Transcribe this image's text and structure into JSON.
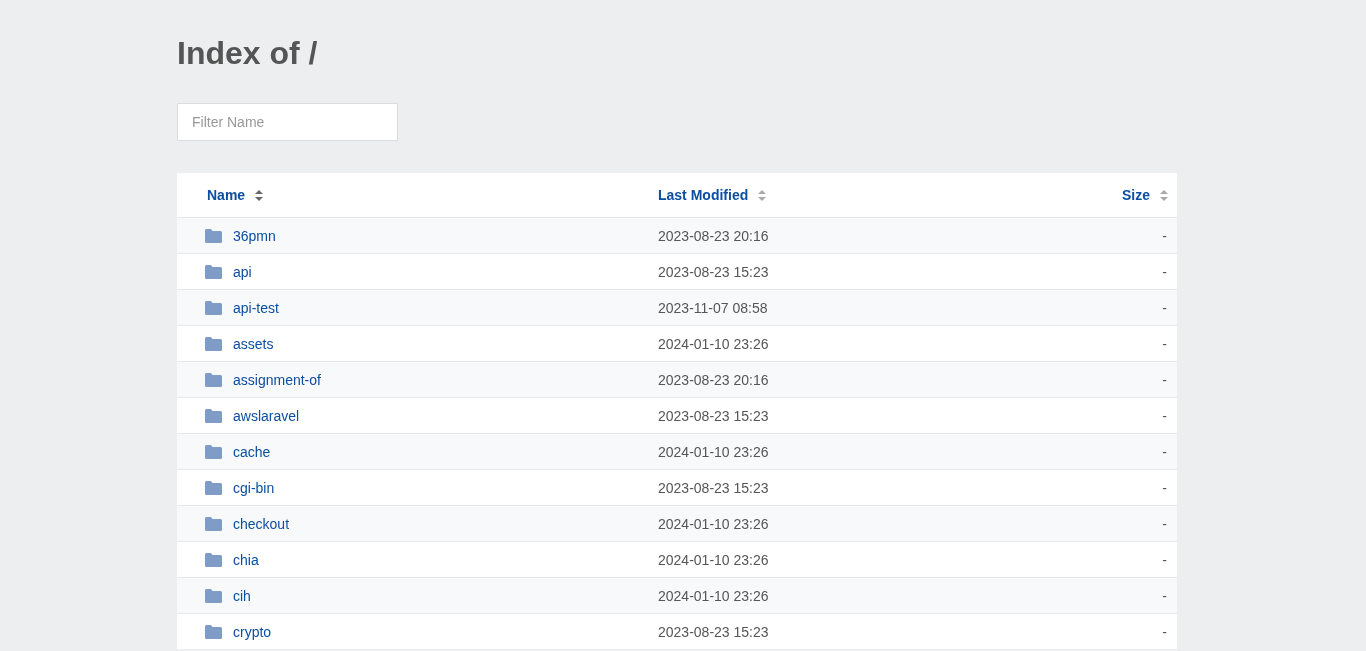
{
  "title": "Index of /",
  "filter": {
    "placeholder": "Filter Name"
  },
  "columns": [
    {
      "label": "Name",
      "sorted": true
    },
    {
      "label": "Last Modified",
      "sorted": false
    },
    {
      "label": "Size",
      "sorted": false
    }
  ],
  "rows": [
    {
      "name": "36pmn",
      "modified": "2023-08-23 20:16",
      "size": "-"
    },
    {
      "name": "api",
      "modified": "2023-08-23 15:23",
      "size": "-"
    },
    {
      "name": "api-test",
      "modified": "2023-11-07 08:58",
      "size": "-"
    },
    {
      "name": "assets",
      "modified": "2024-01-10 23:26",
      "size": "-"
    },
    {
      "name": "assignment-of",
      "modified": "2023-08-23 20:16",
      "size": "-"
    },
    {
      "name": "awslaravel",
      "modified": "2023-08-23 15:23",
      "size": "-"
    },
    {
      "name": "cache",
      "modified": "2024-01-10 23:26",
      "size": "-"
    },
    {
      "name": "cgi-bin",
      "modified": "2023-08-23 15:23",
      "size": "-"
    },
    {
      "name": "checkout",
      "modified": "2024-01-10 23:26",
      "size": "-"
    },
    {
      "name": "chia",
      "modified": "2024-01-10 23:26",
      "size": "-"
    },
    {
      "name": "cih",
      "modified": "2024-01-10 23:26",
      "size": "-"
    },
    {
      "name": "crypto",
      "modified": "2023-08-23 15:23",
      "size": "-"
    }
  ]
}
